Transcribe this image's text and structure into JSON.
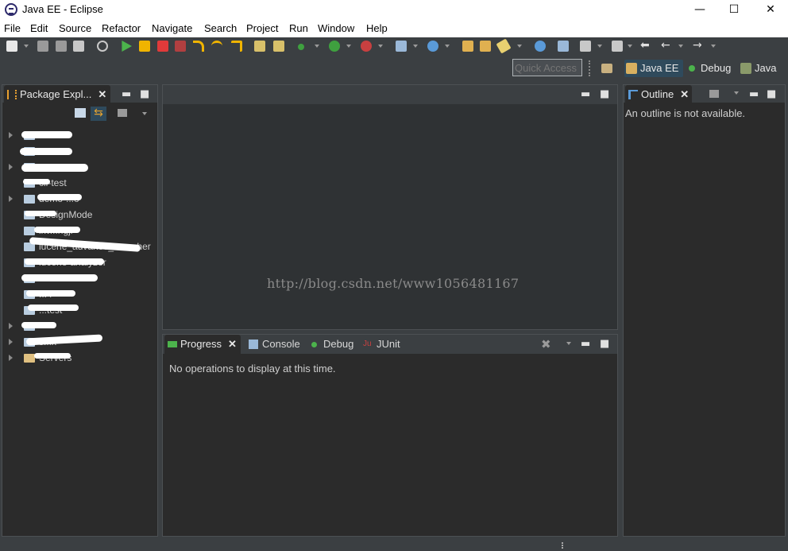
{
  "window": {
    "title": "Java EE - Eclipse",
    "minimize": "—",
    "maximize": "☐",
    "close": "✕"
  },
  "menu": [
    "File",
    "Edit",
    "Source",
    "Refactor",
    "Navigate",
    "Search",
    "Project",
    "Run",
    "Window",
    "Help"
  ],
  "quick_access": {
    "placeholder": "Quick Access"
  },
  "perspectives": [
    {
      "label": "Java EE",
      "icon": "javaee-perspective-icon",
      "active": true
    },
    {
      "label": "Debug",
      "icon": "debug-perspective-icon",
      "active": false
    },
    {
      "label": "Java",
      "icon": "java-perspective-icon",
      "active": false
    }
  ],
  "package_explorer": {
    "tab_label": "Package Expl...",
    "close": "✕",
    "projects": [
      "",
      "",
      "",
      "cli-test",
      "demo-...o",
      "DesignMode",
      "ikv...ngji",
      "lucene_advance_searcher",
      "lucene-analyzer",
      "",
      "...4",
      "...test",
      "",
      "s...x",
      "Servers"
    ]
  },
  "outline": {
    "tab_label": "Outline",
    "close": "✕",
    "message": "An outline is not available."
  },
  "bottom": {
    "tabs": [
      {
        "label": "Progress",
        "active": true,
        "icon": "progress-icon"
      },
      {
        "label": "Console",
        "active": false,
        "icon": "console-icon"
      },
      {
        "label": "Debug",
        "active": false,
        "icon": "debug-icon"
      },
      {
        "label": "JUnit",
        "active": false,
        "icon": "junit-icon"
      }
    ],
    "close": "✕",
    "message": "No operations to display at this time."
  },
  "watermark": "http://blog.csdn.net/www1056481167",
  "colors": {
    "accent_blue": "#2f4a5c",
    "background": "#3b3f42",
    "panel": "#2b2b2b"
  }
}
